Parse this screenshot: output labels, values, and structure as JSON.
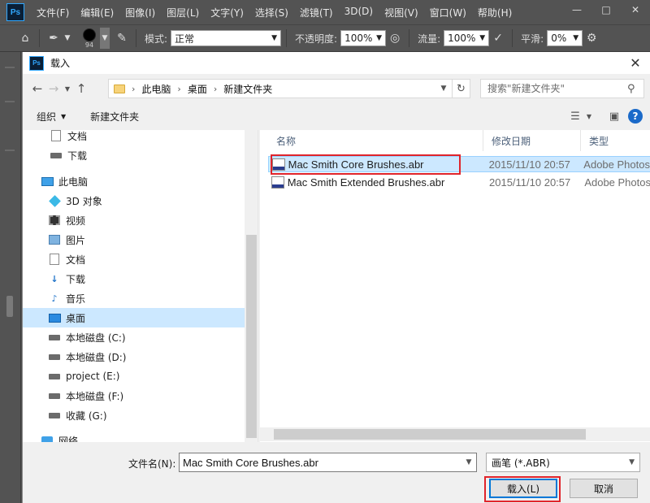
{
  "ps": {
    "logo": "Ps",
    "menu": [
      "文件(F)",
      "编辑(E)",
      "图像(I)",
      "图层(L)",
      "文字(Y)",
      "选择(S)",
      "滤镜(T)",
      "3D(D)",
      "视图(V)",
      "窗口(W)",
      "帮助(H)"
    ],
    "options": {
      "brush_size": "94",
      "mode_label": "模式:",
      "mode_value": "正常",
      "opacity_label": "不透明度:",
      "opacity_value": "100%",
      "flow_label": "流量:",
      "flow_value": "100%",
      "smooth_label": "平滑:",
      "smooth_value": "0%"
    }
  },
  "dialog": {
    "icon": "Ps",
    "title": "载入",
    "breadcrumbs": [
      "此电脑",
      "桌面",
      "新建文件夹"
    ],
    "search_placeholder": "搜索\"新建文件夹\"",
    "organize_label": "组织",
    "new_folder_label": "新建文件夹",
    "nav_items": [
      {
        "label": "文档",
        "icon": "document-icon"
      },
      {
        "label": "下载",
        "icon": "drive-icon"
      },
      {
        "label": "此电脑",
        "icon": "computer-icon"
      },
      {
        "label": "3D 对象",
        "icon": "3d-objects-icon"
      },
      {
        "label": "视频",
        "icon": "video-icon"
      },
      {
        "label": "图片",
        "icon": "pictures-icon"
      },
      {
        "label": "文档",
        "icon": "document-icon"
      },
      {
        "label": "下载",
        "icon": "download-icon"
      },
      {
        "label": "音乐",
        "icon": "music-icon"
      },
      {
        "label": "桌面",
        "icon": "desktop-icon",
        "selected": true
      },
      {
        "label": "本地磁盘 (C:)",
        "icon": "drive-icon"
      },
      {
        "label": "本地磁盘 (D:)",
        "icon": "drive-icon"
      },
      {
        "label": "project (E:)",
        "icon": "drive-icon"
      },
      {
        "label": "本地磁盘 (F:)",
        "icon": "drive-icon"
      },
      {
        "label": "收藏 (G:)",
        "icon": "drive-icon"
      },
      {
        "label": "网络",
        "icon": "network-icon"
      }
    ],
    "columns": {
      "name": "名称",
      "modified": "修改日期",
      "type": "类型"
    },
    "files": [
      {
        "name": "Mac Smith Core Brushes.abr",
        "modified": "2015/11/10 20:57",
        "type": "Adobe Photos",
        "selected": true
      },
      {
        "name": "Mac Smith Extended Brushes.abr",
        "modified": "2015/11/10 20:57",
        "type": "Adobe Photos",
        "selected": false
      }
    ],
    "filename_label": "文件名(N):",
    "filename_value": "Mac Smith Core Brushes.abr",
    "filetype_value": "画笔 (*.ABR)",
    "load_button": "载入(L)",
    "cancel_button": "取消"
  },
  "colors": {
    "accent": "#0078d7",
    "highlight_box": "#e0242b",
    "selection": "#cce8ff"
  }
}
